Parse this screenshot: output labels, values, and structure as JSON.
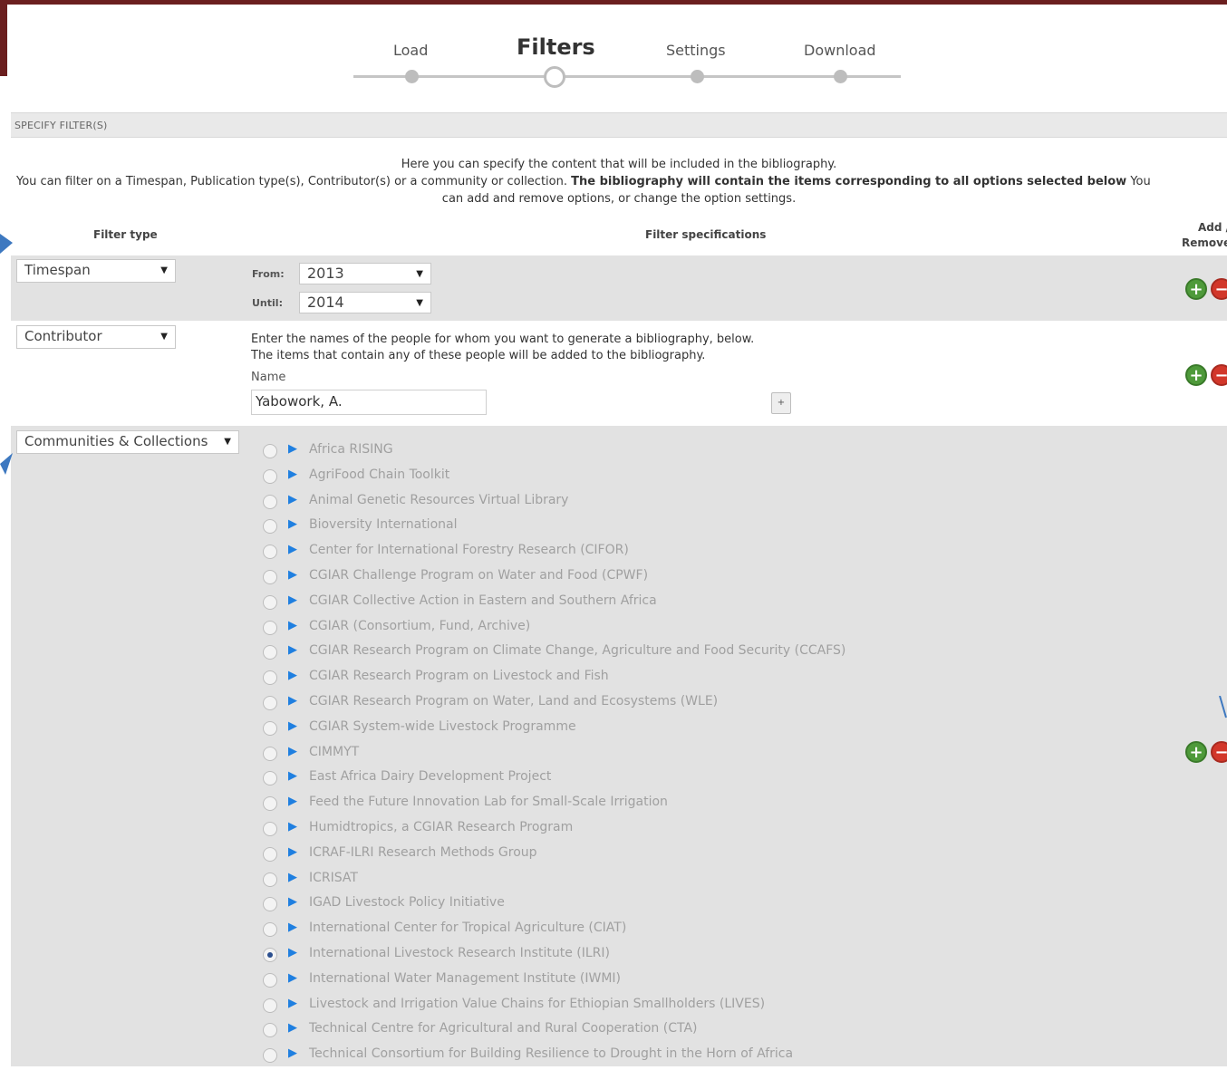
{
  "wizard": {
    "steps": [
      {
        "label": "Load"
      },
      {
        "label": "Filters"
      },
      {
        "label": "Settings"
      },
      {
        "label": "Download"
      }
    ],
    "active_index": 1
  },
  "panel": {
    "header": "SPECIFY FILTER(S)",
    "intro_line1": "Here you can specify the content that will be included in the bibliography.",
    "intro_line2_a": "You can filter on a Timespan, Publication type(s), Contributor(s) or a community or collection. ",
    "intro_line2_b": "The bibliography will contain the items corresponding to all options selected below",
    "intro_line2_c": " You",
    "intro_line3": "can add and remove options, or change the option settings."
  },
  "columns": {
    "filter_type": "Filter type",
    "filter_specs": "Filter specifications",
    "add_remove_line1": "Add /",
    "add_remove_line2": "Remove"
  },
  "filters": {
    "timespan": {
      "type": "Timespan",
      "from_label": "From:",
      "from_value": "2013",
      "until_label": "Until:",
      "until_value": "2014"
    },
    "contributor": {
      "type": "Contributor",
      "help1": "Enter the names of the people for whom you want to generate a bibliography, below.",
      "help2": "The items that contain any of these people will be added to the bibliography.",
      "name_label": "Name",
      "name_value": "Yabowork, A.",
      "add_name_symbol": "+"
    },
    "communities": {
      "type": "Communities & Collections",
      "items": [
        {
          "label": "Africa RISING",
          "checked": false
        },
        {
          "label": "AgriFood Chain Toolkit",
          "checked": false
        },
        {
          "label": "Animal Genetic Resources Virtual Library",
          "checked": false
        },
        {
          "label": "Bioversity International",
          "checked": false
        },
        {
          "label": "Center for International Forestry Research (CIFOR)",
          "checked": false
        },
        {
          "label": "CGIAR Challenge Program on Water and Food (CPWF)",
          "checked": false
        },
        {
          "label": "CGIAR Collective Action in Eastern and Southern Africa",
          "checked": false
        },
        {
          "label": "CGIAR (Consortium, Fund, Archive)",
          "checked": false
        },
        {
          "label": "CGIAR Research Program on Climate Change, Agriculture and Food Security (CCAFS)",
          "checked": false
        },
        {
          "label": "CGIAR Research Program on Livestock and Fish",
          "checked": false
        },
        {
          "label": "CGIAR Research Program on Water, Land and Ecosystems (WLE)",
          "checked": false
        },
        {
          "label": "CGIAR System-wide Livestock Programme",
          "checked": false
        },
        {
          "label": "CIMMYT",
          "checked": false
        },
        {
          "label": "East Africa Dairy Development Project",
          "checked": false
        },
        {
          "label": "Feed the Future Innovation Lab for Small-Scale Irrigation",
          "checked": false
        },
        {
          "label": "Humidtropics, a CGIAR Research Program",
          "checked": false
        },
        {
          "label": "ICRAF-ILRI Research Methods Group",
          "checked": false
        },
        {
          "label": "ICRISAT",
          "checked": false
        },
        {
          "label": "IGAD Livestock Policy Initiative",
          "checked": false
        },
        {
          "label": "International Center for Tropical Agriculture (CIAT)",
          "checked": false
        },
        {
          "label": "International Livestock Research Institute (ILRI)",
          "checked": true
        },
        {
          "label": "International Water Management Institute (IWMI)",
          "checked": false
        },
        {
          "label": "Livestock and Irrigation Value Chains for Ethiopian Smallholders (LIVES)",
          "checked": false
        },
        {
          "label": "Technical Centre for Agricultural and Rural Cooperation (CTA)",
          "checked": false
        },
        {
          "label": "Technical Consortium for Building Resilience to Drought in the Horn of Africa",
          "checked": false
        }
      ]
    }
  },
  "icons": {
    "add": "plus-circle-icon",
    "remove": "minus-circle-icon",
    "expand": "triangle-right-icon",
    "caret": "caret-down-icon"
  },
  "colors": {
    "brand_bar": "#6b1f1f",
    "add_green": "#4e9a3a",
    "remove_red": "#d2372a",
    "tree_blue": "#1f7fe0"
  }
}
